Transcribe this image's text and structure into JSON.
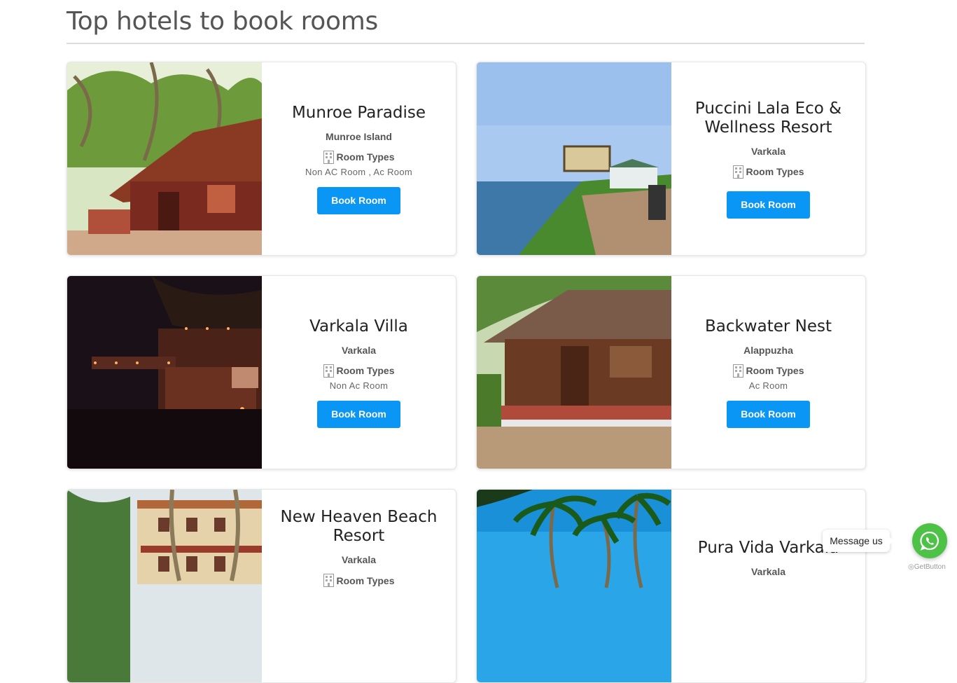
{
  "page": {
    "title": "Top hotels to book rooms"
  },
  "labels": {
    "room_types": "Room Types",
    "book_button": "Book Room"
  },
  "hotels": [
    {
      "name": "Munroe Paradise",
      "location": "Munroe Island",
      "rooms": "Non AC Room , Ac Room"
    },
    {
      "name": "Puccini Lala Eco & Wellness Resort",
      "location": "Varkala",
      "rooms": ""
    },
    {
      "name": "Varkala Villa",
      "location": "Varkala",
      "rooms": "Non Ac Room"
    },
    {
      "name": "Backwater Nest",
      "location": "Alappuzha",
      "rooms": "Ac Room"
    },
    {
      "name": "New Heaven Beach Resort",
      "location": "Varkala",
      "rooms": ""
    },
    {
      "name": "Pura Vida Varkala",
      "location": "Varkala",
      "rooms": ""
    }
  ],
  "whatsapp": {
    "message_label": "Message us",
    "powered_by": "GetButton",
    "color": "#4dc247"
  },
  "colors": {
    "accent": "#0a96f5"
  }
}
